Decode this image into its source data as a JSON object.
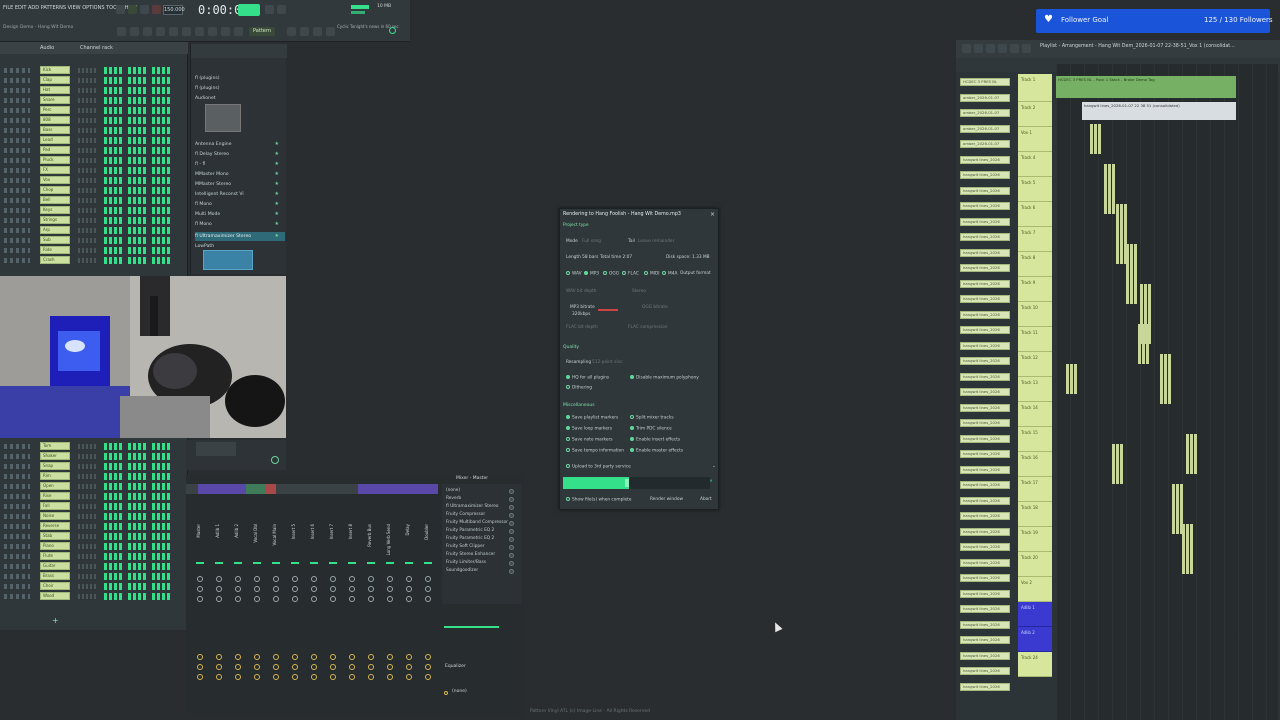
{
  "topbar": {
    "menu": "FILE EDIT ADD PATTERNS VIEW OPTIONS TOOLS HELP",
    "hint": "Design Demo - Hang Wit Demo",
    "time": "0:00:00",
    "tempo": "150.000",
    "pattern": "Pattern",
    "cpu": "10 MB",
    "news": "Cyclic Tonight's news in 60 sec"
  },
  "rack": {
    "tabs": [
      "Audio",
      "Channel rack"
    ],
    "rows": [
      "Kick",
      "Clap",
      "Hat",
      "Snare",
      "Perc",
      "808",
      "Bass",
      "Lead",
      "Pad",
      "Pluck",
      "FX",
      "Vox",
      "Chop",
      "Bell",
      "Keys",
      "Strings",
      "Arp",
      "Sub",
      "Ride",
      "Crash",
      "Tom",
      "Shaker",
      "Snap",
      "Rim",
      "Open",
      "Rise",
      "Fall",
      "Noise",
      "Reverse",
      "Stab",
      "Piano",
      "Flute",
      "Guitar",
      "Brass",
      "Choir",
      "Wood",
      "Marimba",
      "Glass",
      "Texture",
      "Sweep",
      "Impact",
      "Rev FX"
    ],
    "add_label": "+"
  },
  "browser": {
    "items": [
      {
        "label": "fl (plugins)",
        "star": false
      },
      {
        "label": "fl (plugins)",
        "star": false
      },
      {
        "label": "Audionet",
        "star": false
      },
      {
        "label": "Antenna Engine",
        "star": true
      },
      {
        "label": "fl Delay Stereo",
        "star": true
      },
      {
        "label": "fl - fl",
        "star": true
      },
      {
        "label": "MMaster Mono",
        "star": true
      },
      {
        "label": "MMaster Stereo",
        "star": true
      },
      {
        "label": "Intelligent Reconst Vi",
        "star": true
      },
      {
        "label": "fl Mono",
        "star": true
      },
      {
        "label": "Multi Mode",
        "star": true
      },
      {
        "label": "fl Mono",
        "star": true
      },
      {
        "label": "fl Ultramaximizer Stereo",
        "star": true,
        "selected": true
      },
      {
        "label": "LowPath",
        "star": false
      }
    ]
  },
  "mixer": {
    "title": "Mixer - Master",
    "channels": [
      "Master",
      "Adlib 1",
      "Adlib 2",
      "Vocal Dbl",
      "Vocal Main",
      "Insert 5",
      "Insert 6",
      "Insert 7",
      "Insert 8",
      "Reverb Bus",
      "Long Verb Send",
      "Delay",
      "Doubler"
    ],
    "slots": [
      "(none)",
      "Reverb",
      "fl Ultramaximizer Stereo",
      "Fruity Compressor",
      "Fruity Multiband Compressor",
      "Fruity Parametric EQ 2",
      "Fruity Parametric EQ 2",
      "Fruity Soft Clipper",
      "Fruity Stereo Enhancer",
      "Fruity Limiter/Bass",
      "Soundgoodizer"
    ],
    "eq_label": "Equalizer",
    "out_label": "(none)"
  },
  "dialog": {
    "title": "Rendering to Hang Foolish - Hang Wit Demo.mp3",
    "project_type": "Project type",
    "mode_label": "Mode",
    "mode_value": "Full song",
    "tail_label": "Tail",
    "tail_value": "Leave remainder",
    "length_text": "Length 58 bars",
    "total_time": "Total time 2:07",
    "disk_space": "Disk space: 1.33 MB",
    "formats": [
      "WAV",
      "MP3",
      "OGG",
      "FLAC",
      "MIDI",
      "M4A"
    ],
    "output_format": "Output format",
    "wav_bit_depth": "WAV bit depth",
    "stereo_label": "Stereo",
    "mp3_bitrate": "MP3 bitrate",
    "mp3_bitrate_value": "320kbps",
    "ogg_bitrate": "OGG bitrate",
    "flac_bit_depth": "FLAC bit depth",
    "flac_compression": "FLAC compression",
    "quality": "Quality",
    "resampling": "Resampling",
    "resampling_value": "512-point sinc",
    "hq_all_plugins": "HQ for all plugins",
    "disable_max_polyphony": "Disable maximum polyphony",
    "dithering": "Dithering",
    "misc_options": "Miscellaneous",
    "opts": [
      "Save playlist markers",
      "Split mixer tracks",
      "Save loop markers",
      "Trim PDC silence",
      "Save note markers",
      "Enable insert effects",
      "Save tempo information",
      "Enable master effects"
    ],
    "upload": "Upload to 3rd party service",
    "show_when_complete": "Show file(s) when complete",
    "render_btn": "Render window",
    "abort_btn": "Abort",
    "progress": 0.45
  },
  "playlist": {
    "title": "Playlist - Arrangement - Hang Wit Dem_2026-01-07 22-38-51_Vox 1 (consolidat...",
    "pattern_picker": [
      "HCDEC 3 PRES BL",
      "amber_2026-01-07",
      "amber_2026-01-07",
      "amber_2026-01-07",
      "amber_2026-01-07",
      "hangwit lines_2026",
      "hangwit lines_2026",
      "hangwit lines_2026",
      "hangwit lines_2026",
      "hangwit lines_2026",
      "hangwit lines_2026",
      "hangwit lines_2026",
      "hangwit lines_2026",
      "hangwit lines_2026",
      "hangwit lines_2026",
      "hangwit lines_2026",
      "hangwit lines_2026",
      "hangwit lines_2026",
      "hangwit lines_2026",
      "hangwit lines_2026",
      "hangwit lines_2026",
      "hangwit lines_2026",
      "hangwit lines_2026",
      "hangwit lines_2026",
      "hangwit lines_2026",
      "hangwit lines_2026",
      "hangwit lines_2026",
      "hangwit lines_2026",
      "hangwit lines_2026",
      "hangwit lines_2026",
      "hangwit lines_2026",
      "hangwit lines_2026",
      "hangwit lines_2026",
      "hangwit lines_2026",
      "hangwit lines_2026",
      "hangwit lines_2026",
      "hangwit lines_2026",
      "hangwit lines_2026",
      "hangwit lines_2026",
      "hangwit lines_2026"
    ],
    "tracks": [
      "Track 1",
      "Track 2",
      "Vox 1",
      "Track 4",
      "Track 5",
      "Track 6",
      "Track 7",
      "Track 8",
      "Track 9",
      "Track 10",
      "Track 11",
      "Track 12",
      "Track 13",
      "Track 14",
      "Track 15",
      "Track 16",
      "Track 17",
      "Track 18",
      "Track 19",
      "Track 20",
      "Vox 2",
      "Adlib 1",
      "Adlib 2",
      "Track 24"
    ],
    "clip1": "HCDEC 3 PRES BL - Pack 1 Stack - Brake Demo Tag",
    "clip2": "hangwit lines_2026-01-07 22 38 51 (consolidated)"
  },
  "goal": {
    "label": "Follower Goal",
    "count": "125 / 130 Followers",
    "color": "#1a54d8"
  },
  "footer_hint": "Pattern Vinyl ATL (c) Image-Line - All Rights Reserved"
}
